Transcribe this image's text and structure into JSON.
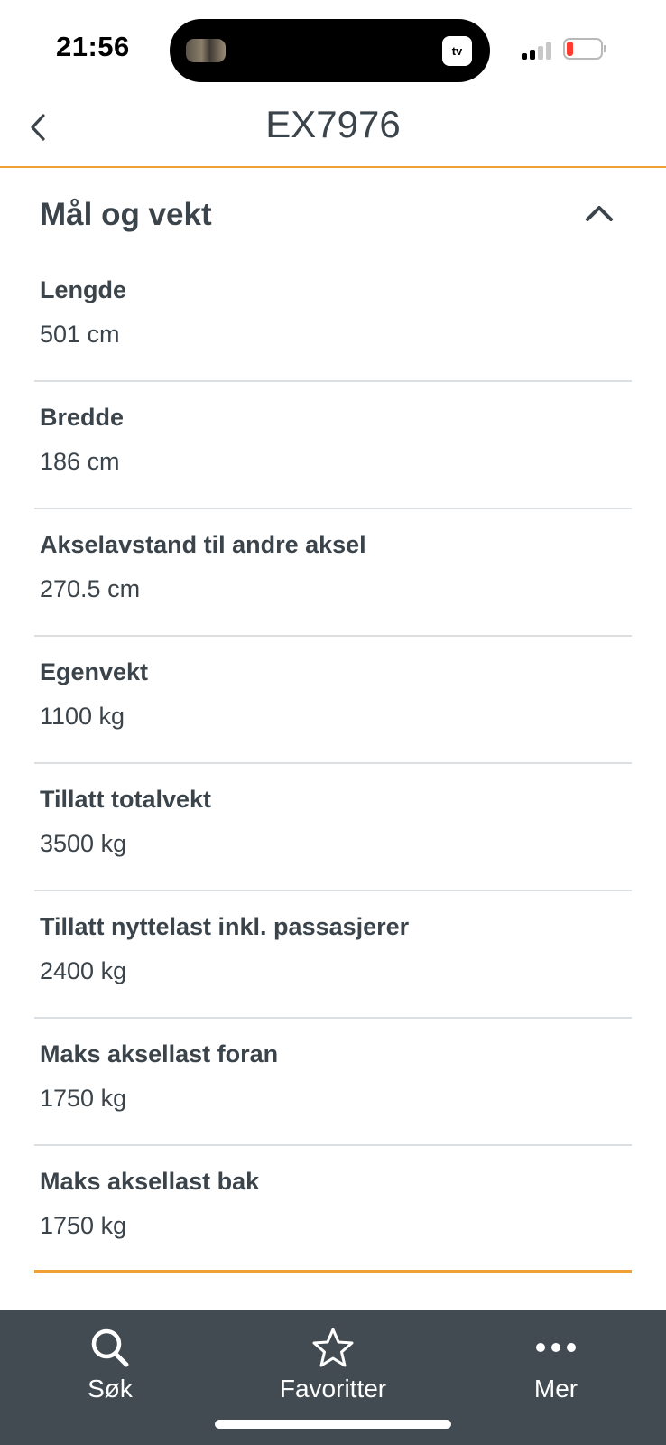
{
  "status_bar": {
    "time": "21:56",
    "tv_badge": "tv",
    "battery_color": "#ff3b30"
  },
  "header": {
    "title": "EX7976",
    "back_icon": "chevron-left-icon"
  },
  "section": {
    "title": "Mål og vekt",
    "toggle_icon": "chevron-up-icon",
    "expanded": true,
    "rows": [
      {
        "label": "Lengde",
        "value": "501 cm"
      },
      {
        "label": "Bredde",
        "value": "186 cm"
      },
      {
        "label": "Akselavstand til andre aksel",
        "value": "270.5 cm"
      },
      {
        "label": "Egenvekt",
        "value": "1100 kg"
      },
      {
        "label": "Tillatt totalvekt",
        "value": "3500 kg"
      },
      {
        "label": "Tillatt nyttelast inkl. passasjerer",
        "value": "2400 kg"
      },
      {
        "label": "Maks aksellast foran",
        "value": "1750 kg"
      },
      {
        "label": "Maks aksellast bak",
        "value": "1750 kg"
      }
    ]
  },
  "tabbar": {
    "tabs": [
      {
        "label": "Søk",
        "icon": "search-icon"
      },
      {
        "label": "Favoritter",
        "icon": "star-icon"
      },
      {
        "label": "Mer",
        "icon": "more-icon"
      }
    ]
  },
  "colors": {
    "accent": "#f0a035",
    "text": "#3b444b",
    "tabbar_bg": "#434b52",
    "divider": "#dcdfe1"
  }
}
